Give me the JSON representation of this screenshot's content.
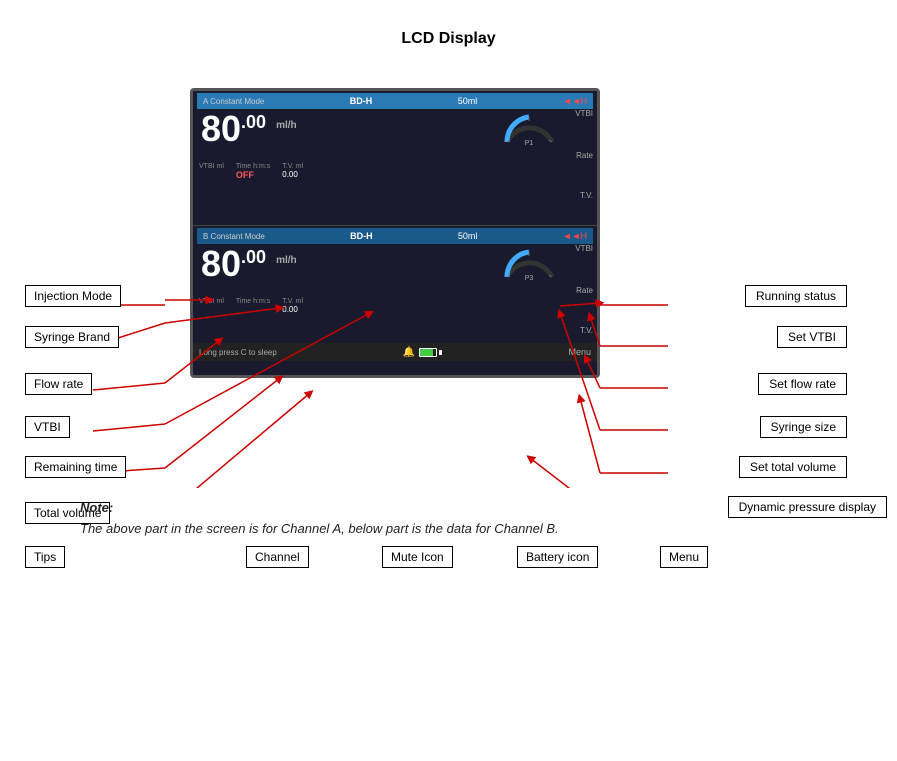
{
  "page": {
    "title": "LCD Display"
  },
  "lcd": {
    "channel_a": {
      "header": {
        "mode": "A Constant Mode",
        "bd": "BD-H",
        "volume": "50ml",
        "plug": "◄◄H"
      },
      "rate": "80",
      "rate_decimal": ".00",
      "rate_unit": "ml/h",
      "vtbi_label": "VTBI",
      "rate_side_label": "Rate",
      "tv_side_label": "T.V.",
      "sub": {
        "vtbi": {
          "label": "VTBI ml",
          "value": ""
        },
        "time": {
          "label": "Time h:m:s",
          "value": "OFF"
        },
        "tv": {
          "label": "T.V. ml",
          "value": "0.00"
        }
      },
      "gauge_label": "P1"
    },
    "channel_b": {
      "header": {
        "mode": "B Constant Mode",
        "bd": "BD-H",
        "volume": "50ml",
        "plug": "◄◄H"
      },
      "rate": "80",
      "rate_decimal": ".00",
      "rate_unit": "ml/h",
      "vtbi_label": "VTBI",
      "rate_side_label": "Rate",
      "tv_side_label": "T.V.",
      "sub": {
        "vtbi": {
          "label": "VTBI ml",
          "value": ""
        },
        "time": {
          "label": "Time h:m:s",
          "value": ""
        },
        "tv": {
          "label": "T.V. ml",
          "value": "0.00"
        }
      },
      "gauge_label": "P3"
    },
    "sleep_text": "Long press C to sleep",
    "menu_label": "Menu"
  },
  "labels": {
    "left": [
      {
        "id": "injection-mode",
        "text": "Injection Mode"
      },
      {
        "id": "syringe-brand",
        "text": "Syringe Brand"
      },
      {
        "id": "flow-rate",
        "text": "Flow rate"
      },
      {
        "id": "vtbi",
        "text": "VTBI"
      },
      {
        "id": "remaining-time",
        "text": "Remaining time"
      },
      {
        "id": "total-volume",
        "text": "Total volume"
      },
      {
        "id": "tips",
        "text": "Tips"
      }
    ],
    "right": [
      {
        "id": "running-status",
        "text": "Running status"
      },
      {
        "id": "set-vtbi",
        "text": "Set VTBI"
      },
      {
        "id": "set-flow-rate",
        "text": "Set flow rate"
      },
      {
        "id": "syringe-size",
        "text": "Syringe size"
      },
      {
        "id": "set-total-volume",
        "text": "Set total volume"
      },
      {
        "id": "dynamic-pressure",
        "text": "Dynamic pressure display"
      }
    ],
    "bottom": [
      {
        "id": "channel",
        "text": "Channel"
      },
      {
        "id": "mute-icon",
        "text": "Mute Icon"
      },
      {
        "id": "battery-icon",
        "text": "Battery icon"
      },
      {
        "id": "menu",
        "text": "Menu"
      }
    ]
  },
  "note": {
    "label": "Note:",
    "text": "The above part in the screen is for Channel A, below part is the data for Channel B."
  }
}
